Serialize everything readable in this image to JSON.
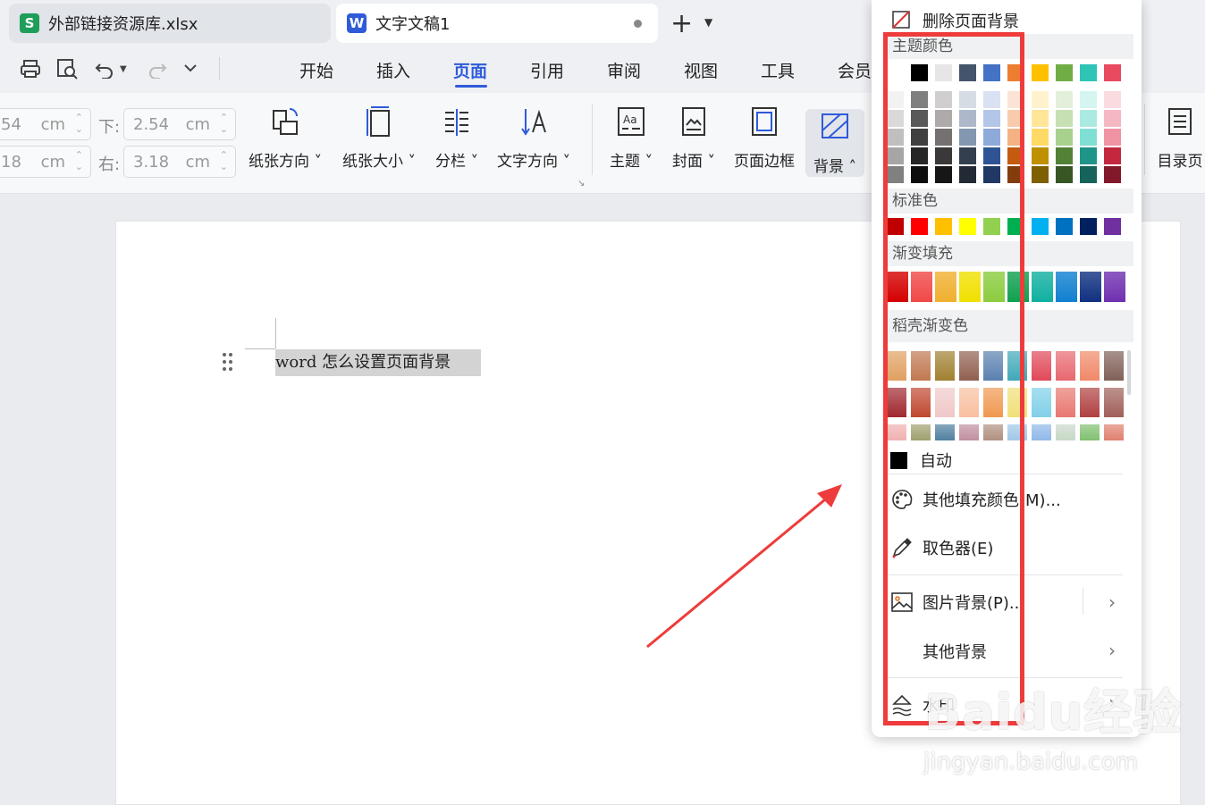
{
  "tabs": [
    {
      "label": "外部链接资源库.xlsx",
      "icon_letter": "S",
      "icon_color": "#1e9e5a"
    },
    {
      "label": "文字文稿1",
      "icon_letter": "W",
      "icon_color": "#2f5bd9"
    }
  ],
  "new_tab_label": "+",
  "menu": {
    "items": [
      "开始",
      "插入",
      "页面",
      "引用",
      "审阅",
      "视图",
      "工具",
      "会员"
    ],
    "active": "页面"
  },
  "margins": {
    "top_partial_value": "54",
    "left_partial_value": "18",
    "bottom_label": "下:",
    "bottom_value": "2.54",
    "right_label": "右:",
    "right_value": "3.18",
    "unit": "cm"
  },
  "ribbon": {
    "orientation": "纸张方向",
    "size": "纸张大小",
    "columns": "分栏",
    "text_direction": "文字方向",
    "theme": "主题",
    "cover": "封面",
    "page_border": "页面边框",
    "background": "背景",
    "toc_page": "目录页"
  },
  "document": {
    "text": "word 怎么设置页面背景"
  },
  "dropdown": {
    "remove_background": "删除页面背景",
    "theme_colors_title": "主题颜色",
    "standard_colors_title": "标准色",
    "gradient_fill_title": "渐变填充",
    "daoke_gradient_title": "稻壳渐变色",
    "auto_label": "自动",
    "more_fill_colors": "其他填充颜色(M)...",
    "color_picker": "取色器(E)",
    "picture_background": "图片背景(P)...",
    "other_background": "其他背景",
    "watermark": "水印",
    "theme_top_row": [
      "#ffffff",
      "#000000",
      "#e7e6e6",
      "#44546a",
      "#4472c4",
      "#ed7d31",
      "#ffc000",
      "#70ad47",
      "#2ec4b6",
      "#e84a5f"
    ],
    "theme_shades": [
      [
        "#f2f2f2",
        "#7f7f7f",
        "#d0cece",
        "#d6dce4",
        "#d9e2f3",
        "#fbe4d5",
        "#fff2cc",
        "#e2efda",
        "#d5f5f1",
        "#fadbe0"
      ],
      [
        "#d9d9d9",
        "#595959",
        "#aeaaaa",
        "#adb9ca",
        "#b4c6e7",
        "#f8cbad",
        "#ffe699",
        "#c6e0b4",
        "#aaeae3",
        "#f5b7c2"
      ],
      [
        "#bfbfbf",
        "#404040",
        "#757171",
        "#8497b0",
        "#8eaadb",
        "#f4b183",
        "#ffd966",
        "#a9d18e",
        "#80dfd5",
        "#f093a3"
      ],
      [
        "#a6a6a6",
        "#262626",
        "#3a3838",
        "#333f4f",
        "#2f5496",
        "#c55a11",
        "#bf9000",
        "#538135",
        "#1f9488",
        "#c4283f"
      ],
      [
        "#808080",
        "#0d0d0d",
        "#161616",
        "#222a35",
        "#1f3864",
        "#843c0c",
        "#7f6000",
        "#375623",
        "#15635b",
        "#82192a"
      ]
    ],
    "standard_colors": [
      "#c00000",
      "#ff0000",
      "#ffc000",
      "#ffff00",
      "#92d050",
      "#00b050",
      "#00b0f0",
      "#0070c0",
      "#002060",
      "#7030a0"
    ],
    "gradient_colors": [
      "#d40000",
      "#f04848",
      "#f0b030",
      "#f0e000",
      "#8ccc40",
      "#10a050",
      "#10b0a0",
      "#1080d0",
      "#103080",
      "#7030b0"
    ],
    "daoke_rows": [
      [
        "#e0a060",
        "#c07850",
        "#a08030",
        "#906050",
        "#5a80b0",
        "#40a8b8",
        "#e04858",
        "#e86870",
        "#f08868",
        "#806058"
      ],
      [
        "#a02830",
        "#c04830",
        "#f0c8c8",
        "#f8c0a0",
        "#f09850",
        "#f0e078",
        "#80d0e8",
        "#e87870",
        "#b04040",
        "#a06058"
      ],
      [
        "#f0b0b0",
        "#a0a070",
        "#5080a0",
        "#c090a0",
        "#b09080",
        "#a0c8e8",
        "#90b8e8",
        "#c8d8c8",
        "#80c070",
        "#e08070"
      ]
    ],
    "red_highlight_color": "#ee3b3b"
  },
  "annotation_arrow_color": "#ee3b3b",
  "watermark_text": "Baidu经验",
  "watermark_url": "jingyan.baidu.com"
}
